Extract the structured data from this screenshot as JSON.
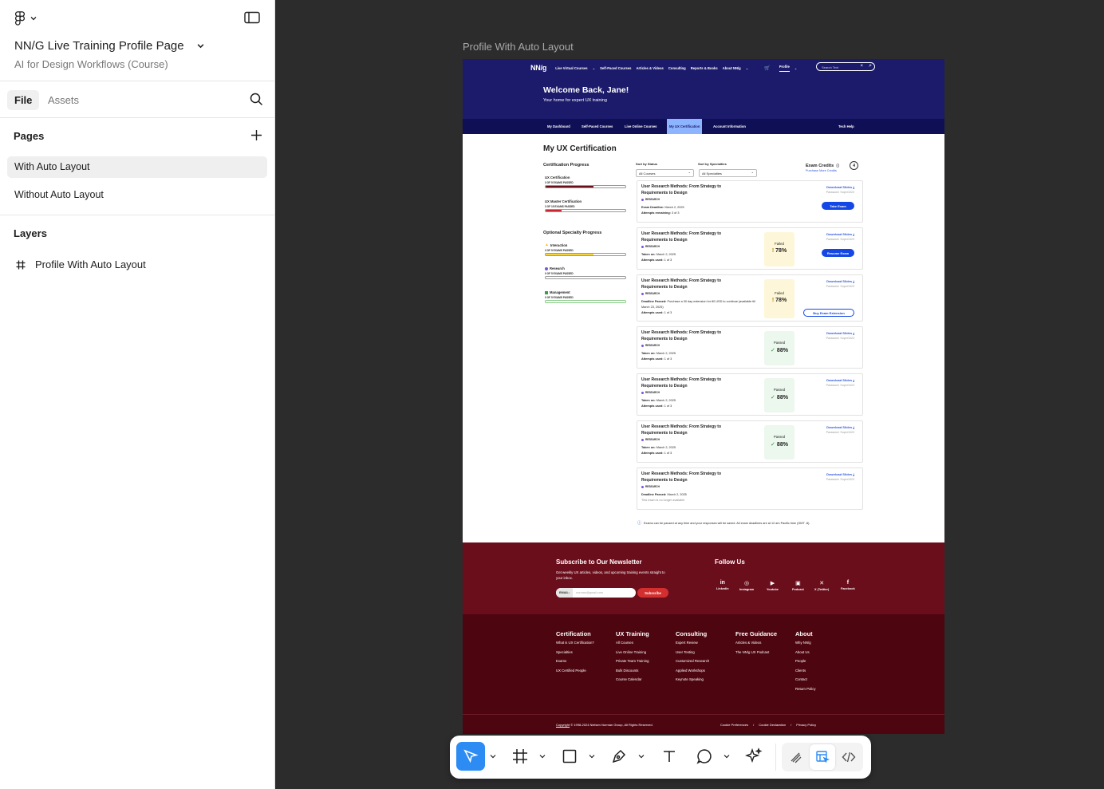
{
  "file": {
    "title": "NN/G Live Training Profile Page",
    "subtitle": "AI for Design Workflows (Course)"
  },
  "panel_tabs": {
    "file": "File",
    "assets": "Assets"
  },
  "pages": {
    "title": "Pages",
    "items": [
      "With Auto Layout",
      "Without Auto Layout"
    ]
  },
  "layers": {
    "title": "Layers",
    "items": [
      "Profile With Auto Layout"
    ]
  },
  "canvas": {
    "frame_label": "Profile With Auto Layout"
  },
  "site": {
    "logo": "NN/g",
    "nav": [
      "Live Virtual Courses",
      "Self-Paced Courses",
      "Articles & Videos",
      "Consulting",
      "Reports & Books",
      "About NN/g"
    ],
    "profile": "Profile",
    "search_placeholder": "Search Text",
    "welcome": "Welcome Back, Jane!",
    "welcome_sub": "Your home for expert UX training",
    "subnav": [
      "My Dashboard",
      "Self-Paced Courses",
      "Live Online Courses",
      "My UX Certification",
      "Account Information"
    ],
    "tech_help": "Tech Help",
    "heading": "My UX Certification",
    "cert_progress_title": "Certification Progress",
    "cert_progress": [
      {
        "label": "UX Certification",
        "status": "3 OF 5 EXAMS PASSED",
        "value": 0.6,
        "color": "#6b0e1c"
      },
      {
        "label": "UX Master Certification",
        "status": "3 OF 15 EXAMS PASSED",
        "value": 0.2,
        "color": "#c9262f"
      }
    ],
    "specialty_title": "Optional Specialty Progress",
    "specialty_progress": [
      {
        "label": "Interaction",
        "status": "3 OF 5 EXAMS PASSED",
        "value": 0.6,
        "color": "#f5d33a"
      },
      {
        "label": "Research",
        "status": "0 OF 5 EXAMS PASSED",
        "value": 0,
        "color": "#7b55d6"
      },
      {
        "label": "Management",
        "status": "0 OF 5 EXAMS PASSED",
        "value": 0,
        "color": "#3a9d4b"
      }
    ],
    "sort_status_label": "Sort by Status",
    "sort_status_value": "All Courses",
    "sort_spec_label": "Sort by Specialties",
    "sort_spec_value": "All Specialties",
    "exam_credits_label": "Exam Credits",
    "exam_credits": "4",
    "purchase_credits": "Purchase More Credits",
    "cards": [
      {
        "title": "User Research Methods: From Strategy to Requirements to Design",
        "tag": "RESEARCH",
        "l1k": "Exam Deadline:",
        "l1v": "March 2, 2025",
        "l2k": "Attempts remaining:",
        "l2v": "3 of 3",
        "dl": "Download Slides",
        "pw": "Password: Super1023",
        "btn": "Take Exam",
        "score_label": "",
        "score_pct": ""
      },
      {
        "title": "User Research Methods: From Strategy to Requirements to Design",
        "tag": "RESEARCH",
        "l1k": "Taken on:",
        "l1v": "March 2, 2025",
        "l2k": "Attempts used:",
        "l2v": "1 of 3",
        "dl": "Download Slides",
        "pw": "Password: Super1023",
        "btn": "Resume Exam",
        "score_label": "Failed",
        "score_pct": "78%"
      },
      {
        "title": "User Research Methods: From Strategy to Requirements to Design",
        "tag": "RESEARCH",
        "l1k": "Deadline Passed:",
        "l1v": "Purchase a 30 day extension for 80 USD to continue (available till March 23, 2025)",
        "l2k": "Attempts used:",
        "l2v": "1 of 3",
        "dl": "Download Slides",
        "pw": "Password: Super1023",
        "btn": "Buy Exam Extension",
        "score_label": "Failed",
        "score_pct": "78%"
      },
      {
        "title": "User Research Methods: From Strategy to Requirements to Design",
        "tag": "RESEARCH",
        "l1k": "Taken on:",
        "l1v": "March 2, 2025",
        "l2k": "Attempts used:",
        "l2v": "1 of 3",
        "dl": "Download Slides",
        "pw": "Password: Super1023",
        "btn": "",
        "score_label": "Passed",
        "score_pct": "88%"
      },
      {
        "title": "User Research Methods: From Strategy to Requirements to Design",
        "tag": "RESEARCH",
        "l1k": "Taken on:",
        "l1v": "March 2, 2025",
        "l2k": "Attempts used:",
        "l2v": "1 of 3",
        "dl": "Download Slides",
        "pw": "Password: Super1023",
        "btn": "",
        "score_label": "Passed",
        "score_pct": "88%"
      },
      {
        "title": "User Research Methods: From Strategy to Requirements to Design",
        "tag": "RESEARCH",
        "l1k": "Taken on:",
        "l1v": "March 2, 2025",
        "l2k": "Attempts used:",
        "l2v": "1 of 3",
        "dl": "Download Slides",
        "pw": "Password: Super1023",
        "btn": "",
        "score_label": "Passed",
        "score_pct": "88%"
      },
      {
        "title": "User Research Methods: From Strategy to Requirements to Design",
        "tag": "RESEARCH",
        "l1k": "Deadline Passed:",
        "l1v": "March 2, 2025",
        "l2k": "",
        "l2v": "This exam is no longer available",
        "dl": "Download Slides",
        "pw": "Password: Super1023",
        "btn": "",
        "score_label": "",
        "score_pct": ""
      }
    ],
    "note": "Exams can be paused at any time and your responses will be saved. All exam deadlines are at 12 am Pacific time (GMT -8).",
    "newsletter_title": "Subscribe to Our Newsletter",
    "newsletter_text": "Get weekly UX articles, videos, and upcoming training events straight to your inbox.",
    "email_label": "EMAIL:",
    "email_placeholder": "norman@gmail.com",
    "subscribe": "Subscribe",
    "follow_title": "Follow Us",
    "social": [
      "LinkedIn",
      "Instagram",
      "Youtube",
      "Podcast",
      "X (Twitter)",
      "Facebook"
    ],
    "footer_cols": [
      {
        "title": "Certification",
        "links": [
          "What is UX Certification?",
          "Specialties",
          "Exams",
          "UX Certified People"
        ]
      },
      {
        "title": "UX Training",
        "links": [
          "All Courses",
          "Live Online Training",
          "Private Team Training",
          "Bulk Discounts",
          "Course Calendar"
        ]
      },
      {
        "title": "Consulting",
        "links": [
          "Expert Review",
          "User Testing",
          "Customized Research",
          "Applied Workshops",
          "Keynote Speaking"
        ]
      },
      {
        "title": "Free Guidance",
        "links": [
          "Articles & Videos",
          "The NN/g UX Podcast"
        ]
      },
      {
        "title": "About",
        "links": [
          "Why NN/g",
          "About Us",
          "People",
          "Clients",
          "Contact",
          "Return Policy"
        ]
      }
    ],
    "copyright_link": "Copyright",
    "copyright": "© 1998-2024 Nielsen Norman Group, All Rights Reserved.",
    "legal": [
      "Cookie Preferences",
      "Cookie Declaration",
      "Privacy Policy"
    ]
  },
  "colors": {
    "accent": "#2c8cf4",
    "nav_bg": "#1b1a6b",
    "footer_bg": "#4d050f"
  }
}
